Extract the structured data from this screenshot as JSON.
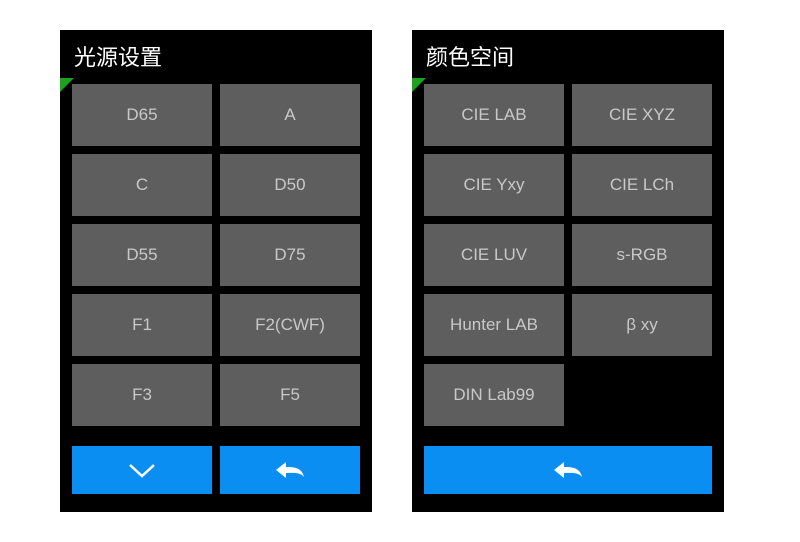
{
  "panels": {
    "light": {
      "title": "光源设置",
      "buttons": [
        "D65",
        "A",
        "C",
        "D50",
        "D55",
        "D75",
        "F1",
        "F2(CWF)",
        "F3",
        "F5"
      ],
      "actions": {
        "down": true,
        "back": true
      }
    },
    "color": {
      "title": "颜色空间",
      "buttons": [
        "CIE LAB",
        "CIE XYZ",
        "CIE Yxy",
        "CIE LCh",
        "CIE LUV",
        "s-RGB",
        "Hunter LAB",
        "β xy",
        "DIN Lab99"
      ],
      "actions": {
        "down": false,
        "back": true
      }
    }
  },
  "colors": {
    "accent": "#0b8ef2",
    "cell": "#5e5e5e",
    "cellText": "#c8c8c8",
    "corner": "#1fa01f"
  }
}
